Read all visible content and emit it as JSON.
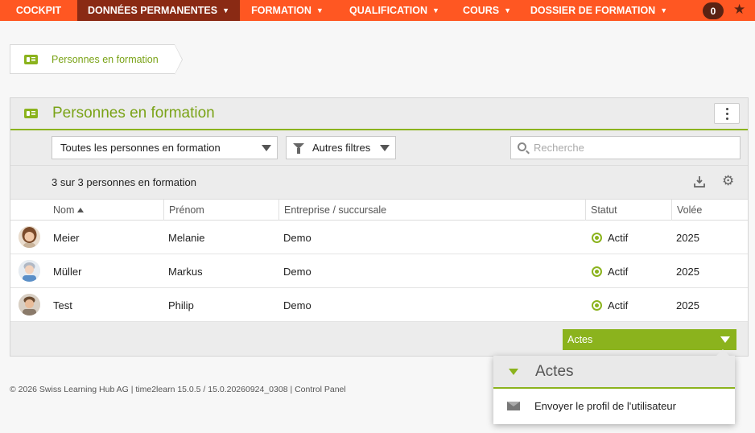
{
  "nav": {
    "items": [
      {
        "label": "COCKPIT",
        "caret": false
      },
      {
        "label": "DONNÉES PERMANENTES",
        "caret": true
      },
      {
        "label": "FORMATION",
        "caret": true
      },
      {
        "label": "QUALIFICATION",
        "caret": true
      },
      {
        "label": "COURS",
        "caret": true
      },
      {
        "label": "DOSSIER DE FORMATION",
        "caret": true
      }
    ],
    "active_index": 1,
    "badge_count": "0",
    "accent_color": "#ff5722",
    "icons": [
      "star-icon"
    ]
  },
  "breadcrumb": {
    "label": "Personnes en formation",
    "icon": "id-card-icon"
  },
  "panel": {
    "title": "Personnes en formation",
    "icon": "id-card-icon",
    "accent_color": "#8bb31d",
    "filter_select_value": "Toutes les personnes en formation",
    "filter_button_label": "Autres filtres",
    "search_placeholder": "Recherche",
    "count_text": "3 sur 3 personnes en formation",
    "columns": [
      "Nom",
      "Prénom",
      "Entreprise / succursale",
      "Statut",
      "Volée"
    ],
    "sort_column": "Nom",
    "rows": [
      {
        "nom": "Meier",
        "prenom": "Melanie",
        "entreprise": "Demo",
        "statut": "Actif",
        "volee": "2025"
      },
      {
        "nom": "Müller",
        "prenom": "Markus",
        "entreprise": "Demo",
        "statut": "Actif",
        "volee": "2025"
      },
      {
        "nom": "Test",
        "prenom": "Philip",
        "entreprise": "Demo",
        "statut": "Actif",
        "volee": "2025"
      }
    ],
    "actions_label": "Actes"
  },
  "dropdown": {
    "title": "Actes",
    "items": [
      {
        "label": "Envoyer le profil de l'utilisateur",
        "icon": "envelope-icon"
      }
    ]
  },
  "footer": {
    "text": "© 2026 Swiss Learning Hub AG  |  time2learn 15.0.5 / 15.0.20260924_0308  |  Control Panel"
  }
}
